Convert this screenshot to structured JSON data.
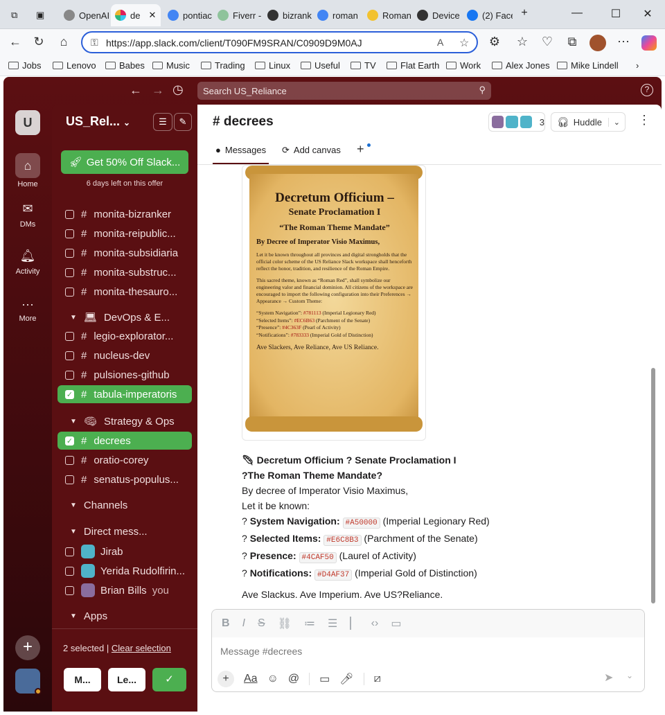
{
  "browser": {
    "tabs": [
      {
        "label": "OpenAI"
      },
      {
        "label": "de"
      },
      {
        "label": "pontiac"
      },
      {
        "label": "Fiverr -"
      },
      {
        "label": "bizrank"
      },
      {
        "label": "roman"
      },
      {
        "label": "Roman"
      },
      {
        "label": "Device"
      },
      {
        "label": "(2) Face"
      }
    ],
    "url": "https://app.slack.com/client/T090FM9SRAN/C0909D9M0AJ",
    "bookmarks": [
      "Jobs",
      "Lenovo",
      "Babes",
      "Music",
      "Trading",
      "Linux",
      "Useful",
      "TV",
      "Flat Earth",
      "Work",
      "Alex Jones",
      "Mike Lindell"
    ]
  },
  "slack": {
    "search_placeholder": "Search US_Reliance",
    "workspace_initial": "U",
    "workspace_name": "US_Rel...",
    "rail": {
      "home": "Home",
      "dms": "DMs",
      "activity": "Activity",
      "more": "More"
    },
    "promo": {
      "button": "Get 50% Off Slack...",
      "note": "6 days left on this offer"
    },
    "channels_top": [
      {
        "name": "monita-bizranker"
      },
      {
        "name": "monita-reipublic..."
      },
      {
        "name": "monita-subsidiaria"
      },
      {
        "name": "monita-substruc..."
      },
      {
        "name": "monita-thesauro..."
      }
    ],
    "section_devops": "DevOps & E...",
    "channels_devops": [
      {
        "name": "legio-explorator..."
      },
      {
        "name": "nucleus-dev"
      },
      {
        "name": "pulsiones-github"
      },
      {
        "name": "tabula-imperatoris"
      }
    ],
    "section_strategy": "Strategy & Ops",
    "channels_strategy": [
      {
        "name": "decrees"
      },
      {
        "name": "oratio-corey"
      },
      {
        "name": "senatus-populus..."
      }
    ],
    "section_channels": "Channels",
    "section_dms": "Direct mess...",
    "dms": [
      {
        "name": "Jirab",
        "suffix": ""
      },
      {
        "name": "Yerida Rudolfirin...",
        "suffix": ""
      },
      {
        "name": "Brian Bills",
        "suffix": "you"
      }
    ],
    "section_apps": "Apps",
    "selection": {
      "count_text": "2 selected |",
      "clear": "Clear selection",
      "btn1": "M...",
      "btn2": "Le..."
    },
    "header": {
      "channel": "decrees",
      "member_count": "3",
      "huddle": "Huddle"
    },
    "tabs": {
      "messages": "Messages",
      "add_canvas": "Add canvas"
    },
    "scroll": {
      "title": "Decretum Officium –",
      "sub1": "Senate Proclamation I",
      "sub2": "“The Roman Theme Mandate”",
      "by": "By Decree of Imperator Visio Maximus,",
      "p1": "Let it be known throughout all provinces and digital strongholds that the official color scheme of the US Reliance Slack workspace shall henceforth reflect the honor, tradition, and resilience of the Roman Empire.",
      "p2": "This sacred theme, known as “Roman Red”, shall symbolize our engineering valor and financial dominion. All citizens of the workspace are encouraged to import the following configuration into their Preferences → Appearance → Custom Theme:",
      "l1a": "“System Navigation”:",
      "l1b": "#781113",
      "l1c": "(Imperial Legionary Red)",
      "l2a": "“Selected Items”:",
      "l2b": "#EC6B63",
      "l2c": "(Parchment of the Senate)",
      "l3a": "“Presence”:",
      "l3b": "#4C363F",
      "l3c": "(Pearl of Activity)",
      "l4a": "“Notifications”:",
      "l4b": "#783333",
      "l4c": "(Imperial Gold of Distinction)",
      "closing": "Ave Slackers, Ave Reliance, Ave US Reliance."
    },
    "message": {
      "line1": "Decretum Officium ? Senate Proclamation I",
      "line2": "?The Roman Theme Mandate?",
      "line3": "By decree of Imperator Visio Maximus,",
      "line4": "Let it be known:",
      "items": [
        {
          "label": "System Navigation:",
          "code": "#A50000",
          "desc": "(Imperial Legionary Red)"
        },
        {
          "label": "Selected Items:",
          "code": "#E6C8B3",
          "desc": "(Parchment of the Senate)"
        },
        {
          "label": "Presence:",
          "code": "#4CAF50",
          "desc": "(Laurel of Activity)"
        },
        {
          "label": "Notifications:",
          "code": "#D4AF37",
          "desc": "(Imperial Gold of Distinction)"
        }
      ],
      "bullet": "?",
      "closing": "Ave Slackus. Ave Imperium. Ave US?Reliance."
    },
    "composer_placeholder": "Message #decrees"
  },
  "colors": {
    "sidebar": "#5a0f12",
    "selected": "#4caf50",
    "accent": "#2b5fd9"
  }
}
